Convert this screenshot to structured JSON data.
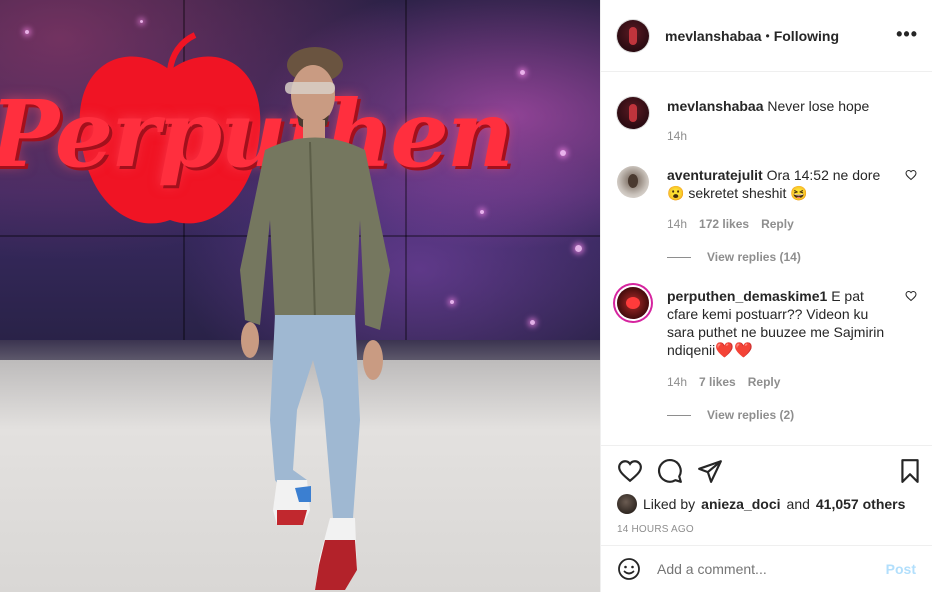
{
  "post": {
    "username": "mevlanshabaa",
    "separator": "•",
    "follow_status": "Following",
    "more_icon": "•••",
    "caption": {
      "username": "mevlanshabaa",
      "text": "Never lose hope",
      "time": "14h"
    }
  },
  "photo": {
    "logo_text": "Perputhen",
    "wall_color": "#2a2146",
    "logo_color": "#ff2f3e"
  },
  "comments": [
    {
      "username": "aventuratejulit",
      "text_line1": "Ora 14:52 ne dore",
      "text_line2_prefix": "😮 sekretet sheshit ",
      "text_line2_suffix": "😆",
      "time": "14h",
      "likes": "172 likes",
      "reply": "Reply",
      "view_replies": "View replies (14)"
    },
    {
      "username": "perputhen_demaskime1",
      "text": "E pat cfare kemi postuarr?? Videon ku sara puthet ne buuzee me Sajmirin ndiqenii",
      "hearts": "❤️❤️",
      "time": "14h",
      "likes": "7 likes",
      "reply": "Reply",
      "view_replies": "View replies (2)"
    }
  ],
  "actions": {
    "like_icon": "heart-icon",
    "comment_icon": "comment-icon",
    "share_icon": "share-icon",
    "save_icon": "bookmark-icon"
  },
  "likes": {
    "prefix": "Liked by",
    "user": "anieza_doci",
    "and": "and",
    "others": "41,057 others"
  },
  "timestamp": "14 HOURS AGO",
  "add_comment": {
    "placeholder": "Add a comment...",
    "post_label": "Post",
    "post_color": "#b2dffc"
  }
}
